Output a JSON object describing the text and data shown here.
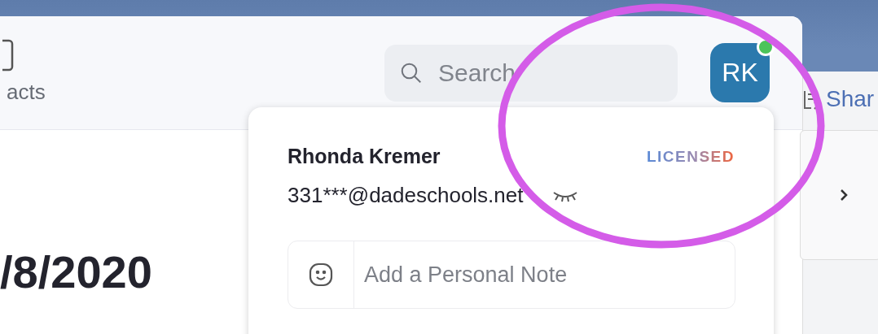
{
  "toolbar": {
    "nav_label": "acts",
    "search": {
      "placeholder": "Search"
    },
    "avatar": {
      "initials": "RK",
      "online": true
    }
  },
  "content": {
    "date": "/8/2020"
  },
  "profile_popup": {
    "name": "Rhonda Kremer",
    "badge": "LICENSED",
    "email": "331***@dadeschools.net",
    "note": {
      "placeholder": "Add a Personal Note"
    }
  },
  "side_window": {
    "button": "Shar"
  },
  "annotation": {
    "kind": "ellipse",
    "color": "#d45ce8"
  }
}
